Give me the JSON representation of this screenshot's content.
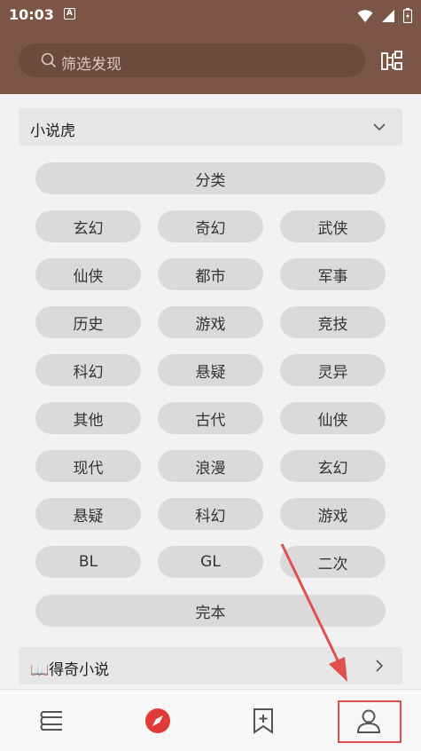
{
  "status_bar": {
    "time": "10:03",
    "badge": "A"
  },
  "search": {
    "placeholder": "筛选发现"
  },
  "sections": [
    {
      "title": "小说虎",
      "expanded": true
    },
    {
      "title": "📖得奇小说",
      "expanded": false
    }
  ],
  "chips": {
    "header": "分类",
    "grid": [
      "玄幻",
      "奇幻",
      "武侠",
      "仙侠",
      "都市",
      "军事",
      "历史",
      "游戏",
      "竞技",
      "科幻",
      "悬疑",
      "灵异",
      "其他",
      "古代",
      "仙侠",
      "现代",
      "浪漫",
      "玄幻",
      "悬疑",
      "科幻",
      "游戏",
      "BL",
      "GL",
      "二次"
    ],
    "footer": "完本"
  },
  "bottom_nav": {
    "items": [
      "bookshelf-icon",
      "explore-icon",
      "bookmark-add-icon",
      "profile-icon"
    ],
    "active": "explore-icon",
    "active_color": "#e23a36"
  },
  "colors": {
    "header_bg": "#7b5646",
    "annotation": "#e0504f"
  }
}
